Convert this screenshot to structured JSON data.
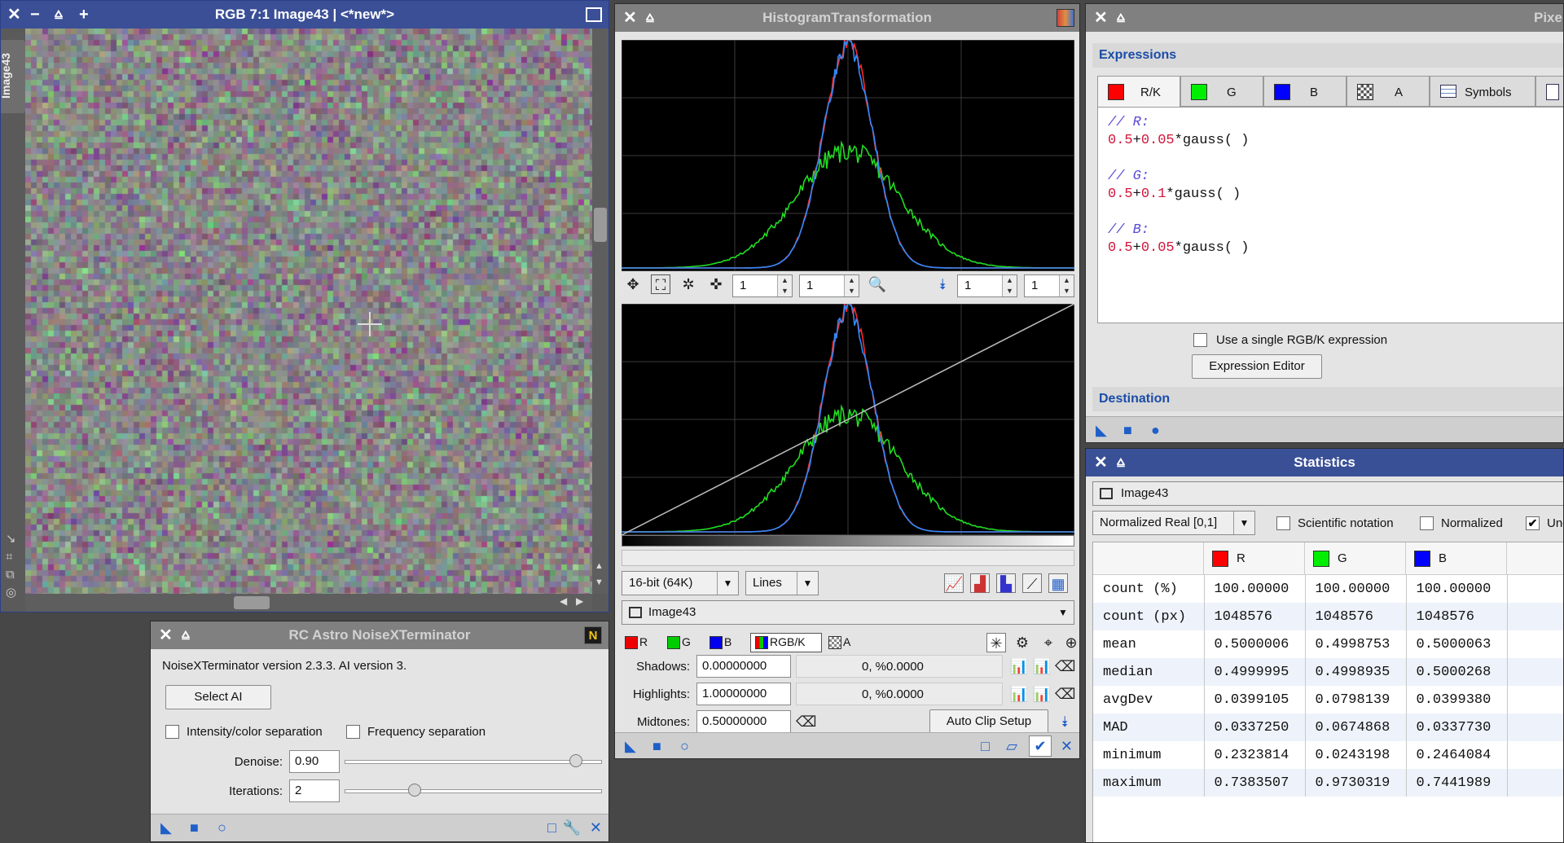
{
  "image_window": {
    "title": "RGB 7:1 Image43 | <*new*>",
    "side_tab": "Image43",
    "title_icons": [
      "close-icon",
      "minimize-icon",
      "shade-icon",
      "plus-icon"
    ]
  },
  "histogram": {
    "title": "HistogramTransformation",
    "zoom_x1": "1",
    "zoom_y1": "1",
    "zoom_x2": "1",
    "zoom_y2": "1",
    "resolution": "16-bit (64K)",
    "graph_style": "Lines",
    "view": "Image43",
    "channels": {
      "r": "R",
      "g": "G",
      "b": "B",
      "rgbk": "RGB/K",
      "a": "A"
    },
    "shadows_label": "Shadows:",
    "shadows_value": "0.00000000",
    "shadows_clip": "0, %0.0000",
    "highlights_label": "Highlights:",
    "highlights_value": "1.00000000",
    "highlights_clip": "0, %0.0000",
    "midtones_label": "Midtones:",
    "midtones_value": "0.50000000",
    "auto_clip": "Auto Clip Setup",
    "colors": {
      "red": "#ff2a2a",
      "green": "#22dd22",
      "blue": "#2e8bff"
    }
  },
  "pixelmath": {
    "title": "Pixel",
    "section_expressions": "Expressions",
    "tabs": [
      "R/K",
      "G",
      "B",
      "A",
      "Symbols"
    ],
    "expr_lines": [
      {
        "comment": "// R:",
        "code": [
          "0.5",
          "+",
          "0.05",
          "*gauss( )"
        ]
      },
      {
        "comment": "// G:",
        "code": [
          "0.5",
          "+",
          "0.1",
          "*gauss( )"
        ]
      },
      {
        "comment": "// B:",
        "code": [
          "0.5",
          "+",
          "0.05",
          "*gauss( )"
        ]
      }
    ],
    "single_expression": "Use a single RGB/K expression",
    "expression_editor": "Expression Editor",
    "section_destination": "Destination"
  },
  "statistics": {
    "title": "Statistics",
    "view": "Image43",
    "range": "Normalized Real [0,1]",
    "scientific": "Scientific notation",
    "normalized": "Normalized",
    "unclipped": "Uncl",
    "headers": [
      "R",
      "G",
      "B"
    ],
    "rows": [
      {
        "label": "count (%)",
        "r": "100.00000",
        "g": "100.00000",
        "b": "100.00000"
      },
      {
        "label": "count (px)",
        "r": "1048576",
        "g": "1048576",
        "b": "1048576"
      },
      {
        "label": "mean",
        "r": "0.5000006",
        "g": "0.4998753",
        "b": "0.5000063"
      },
      {
        "label": "median",
        "r": "0.4999995",
        "g": "0.4998935",
        "b": "0.5000268"
      },
      {
        "label": "avgDev",
        "r": "0.0399105",
        "g": "0.0798139",
        "b": "0.0399380"
      },
      {
        "label": "MAD",
        "r": "0.0337250",
        "g": "0.0674868",
        "b": "0.0337730"
      },
      {
        "label": "minimum",
        "r": "0.2323814",
        "g": "0.0243198",
        "b": "0.2464084"
      },
      {
        "label": "maximum",
        "r": "0.7383507",
        "g": "0.9730319",
        "b": "0.7441989"
      }
    ]
  },
  "noisex": {
    "title": "RC Astro NoiseXTerminator",
    "badge": "N",
    "version": "NoiseXTerminator version 2.3.3. AI version 3.",
    "select_ai": "Select AI",
    "intensity_sep": "Intensity/color separation",
    "freq_sep": "Frequency separation",
    "denoise_label": "Denoise:",
    "denoise_value": "0.90",
    "denoise_level": 0.9,
    "iterations_label": "Iterations:",
    "iterations_value": "2",
    "iterations_level": 0.27
  }
}
